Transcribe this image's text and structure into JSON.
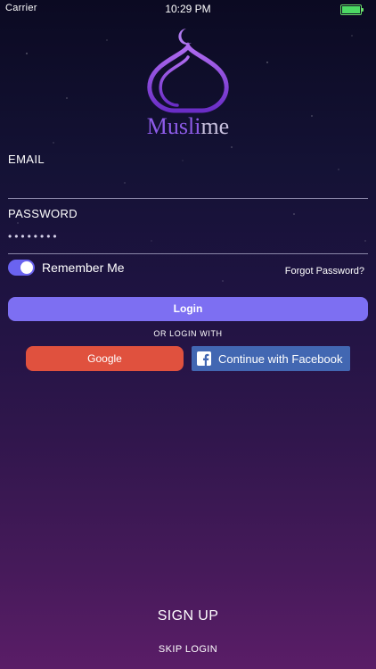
{
  "status_bar": {
    "carrier": "Carrier ",
    "time": "10:29 PM",
    "battery_level": 1.0
  },
  "brand": {
    "name_part1": "Musli",
    "name_part2": "me",
    "logo_icon": "mosque-dome-crescent-icon",
    "colors": {
      "primary": "#8d5be8",
      "secondary": "#c8c0de"
    }
  },
  "form": {
    "email_label": "EMAIL",
    "email_value": "",
    "password_label": "PASSWORD",
    "password_value": "••••••••",
    "remember_me": {
      "label": "Remember Me",
      "checked": true
    },
    "forgot_password": "Forgot Password?"
  },
  "actions": {
    "login_label": "Login",
    "or_text": "OR LOGIN WITH",
    "google_label": "Google",
    "facebook_label": "Continue with Facebook",
    "facebook_icon": "facebook-icon",
    "signup_label": "SIGN UP",
    "skip_label": "SKIP LOGIN"
  },
  "colors": {
    "login_button": "#7d6ff2",
    "google_button": "#e0513e",
    "facebook_button": "#4267b2",
    "toggle_on": "#6a63f0"
  }
}
